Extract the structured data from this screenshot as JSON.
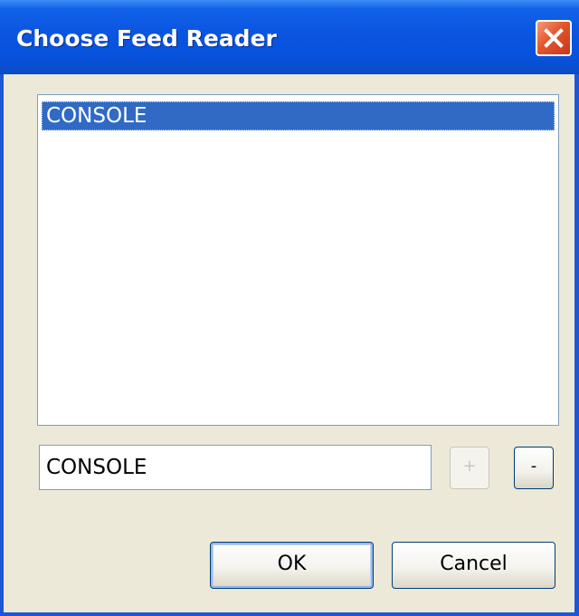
{
  "window": {
    "title": "Choose Feed Reader",
    "close_icon": "close-icon",
    "colors": {
      "titlebar": "#0752dd",
      "dialog_bg": "#ece9d8",
      "selection": "#316ac5",
      "close_button": "#e3562d"
    }
  },
  "reader_list": {
    "items": [
      {
        "label": "CONSOLE",
        "selected": true
      }
    ]
  },
  "reader_input": {
    "value": "CONSOLE"
  },
  "buttons": {
    "add_label": "+",
    "add_enabled": false,
    "remove_label": "-",
    "ok_label": "OK",
    "cancel_label": "Cancel"
  }
}
